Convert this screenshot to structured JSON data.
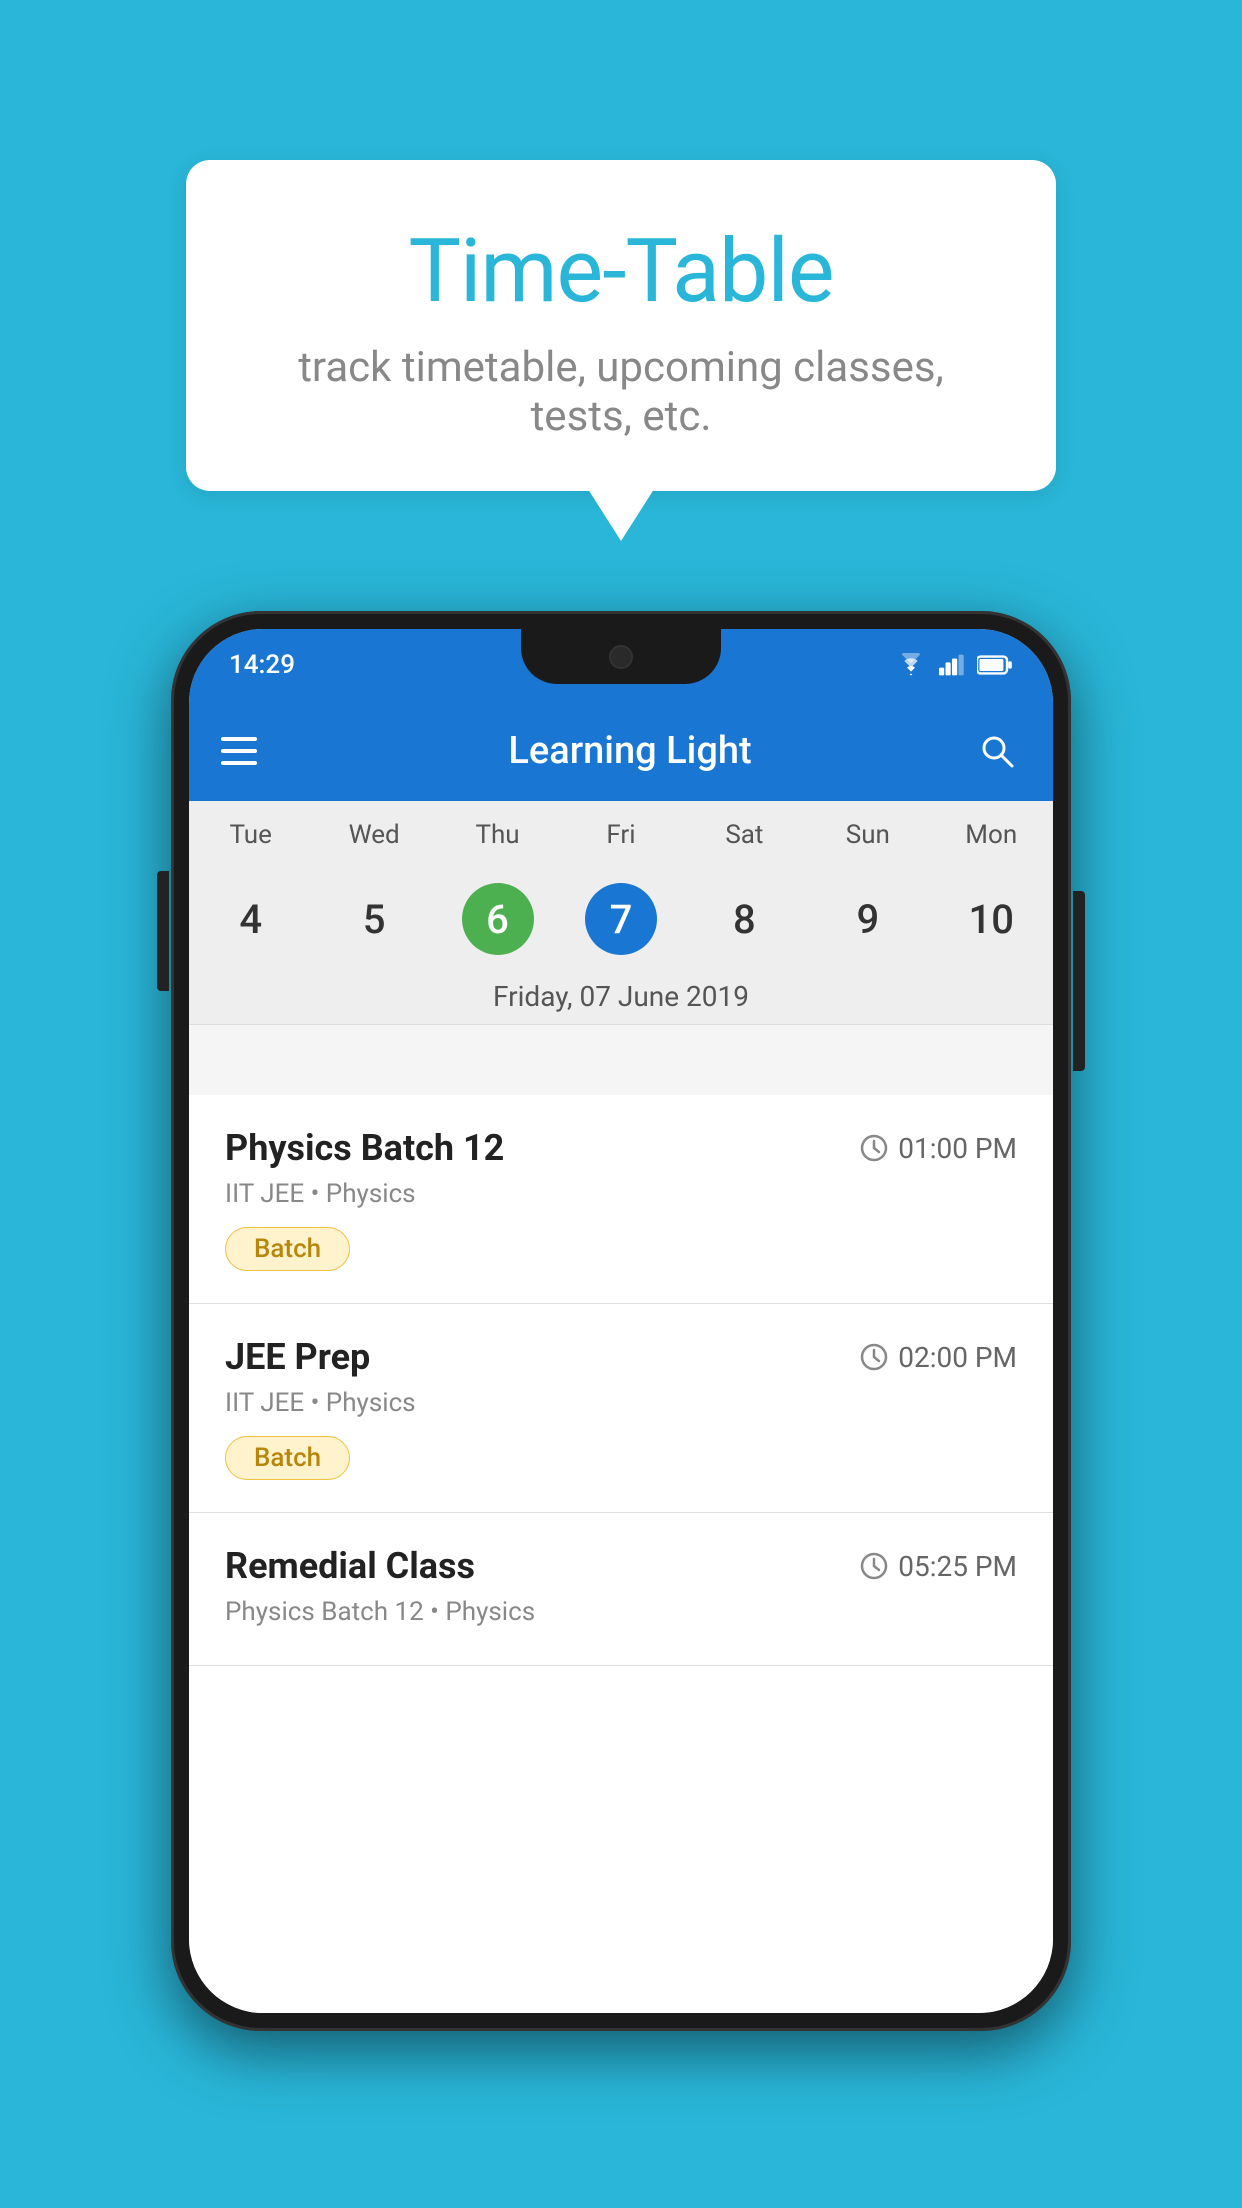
{
  "background": {
    "color": "#29b6d8"
  },
  "tooltip": {
    "title": "Time-Table",
    "subtitle": "track timetable, upcoming classes, tests, etc."
  },
  "phone": {
    "status_bar": {
      "time": "14:29"
    },
    "app_bar": {
      "title": "Learning Light",
      "hamburger_label": "menu",
      "search_label": "search"
    },
    "calendar": {
      "days": [
        {
          "label": "Tue",
          "number": "4"
        },
        {
          "label": "Wed",
          "number": "5"
        },
        {
          "label": "Thu",
          "number": "6",
          "style": "green"
        },
        {
          "label": "Fri",
          "number": "7",
          "style": "blue"
        },
        {
          "label": "Sat",
          "number": "8"
        },
        {
          "label": "Sun",
          "number": "9"
        },
        {
          "label": "Mon",
          "number": "10"
        }
      ],
      "selected_date": "Friday, 07 June 2019"
    },
    "schedule": [
      {
        "title": "Physics Batch 12",
        "time": "01:00 PM",
        "meta": "IIT JEE • Physics",
        "badge": "Batch"
      },
      {
        "title": "JEE Prep",
        "time": "02:00 PM",
        "meta": "IIT JEE • Physics",
        "badge": "Batch"
      },
      {
        "title": "Remedial Class",
        "time": "05:25 PM",
        "meta": "Physics Batch 12 • Physics",
        "badge": ""
      }
    ]
  }
}
